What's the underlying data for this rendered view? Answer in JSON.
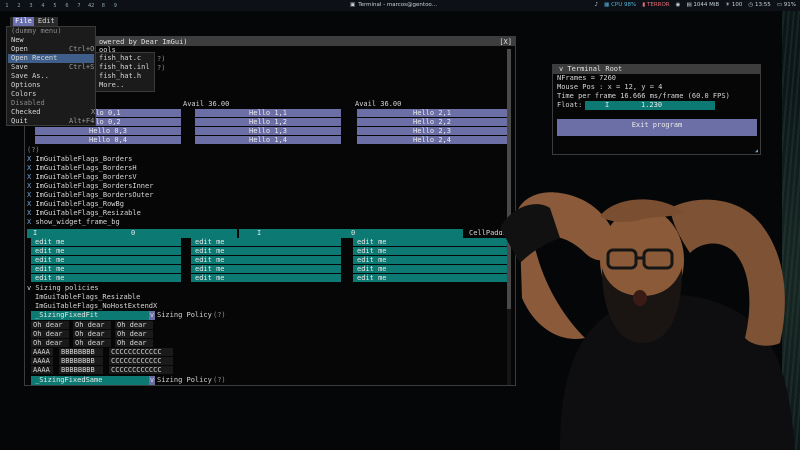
{
  "topbar": {
    "workspaces": [
      "1",
      "2",
      "3",
      "4",
      "5",
      "6",
      "7",
      "8",
      "9"
    ],
    "workspace_count": "42",
    "window_title": "Terminal - marcos@gentoo...",
    "cpu": "CPU 98%",
    "temp": "TERROR",
    "memory": "1044 MiB",
    "brightness": "100",
    "clock": "13:55",
    "battery": "91%"
  },
  "menubar": {
    "file": "File",
    "edit": "Edit"
  },
  "file_menu": {
    "header": "(dummy menu)",
    "items": [
      {
        "label": "New",
        "shortcut": ""
      },
      {
        "label": "Open",
        "shortcut": "Ctrl+O"
      },
      {
        "label": "Open Recent",
        "shortcut": ""
      },
      {
        "label": "Save",
        "shortcut": "Ctrl+S"
      },
      {
        "label": "Save As..",
        "shortcut": ""
      },
      {
        "label": "Options",
        "shortcut": ""
      },
      {
        "label": "Colors",
        "shortcut": ""
      },
      {
        "label": "Disabled",
        "shortcut": ""
      },
      {
        "label": "Checked",
        "shortcut": "X"
      },
      {
        "label": "Quit",
        "shortcut": "Alt+F4"
      }
    ]
  },
  "recent_menu": {
    "items": [
      "fish_hat.c",
      "fish_hat.inl",
      "fish_hat.h",
      "More.."
    ]
  },
  "imgui_window": {
    "title": "owered by Dear ImGui)",
    "close": "[X]",
    "line_tools": "ools",
    "q1": "?)",
    "q2": "?)",
    "avail1": "Avail 36.00",
    "avail2": "Avail 36.00",
    "col0": [
      "lo 0,1",
      "lo 0,2",
      "Hello 0,3",
      "Hello 0,4"
    ],
    "col1": [
      "Hello 1,1",
      "Hello 1,2",
      "Hello 1,3",
      "Hello 1,4"
    ],
    "col2": [
      "Hello 2,1",
      "Hello 2,2",
      "Hello 2,3",
      "Hello 2,4"
    ],
    "q3": "(?)",
    "flags": [
      "ImGuiTableFlags_Borders",
      "ImGuiTableFlags_BordersH",
      "ImGuiTableFlags_BordersV",
      "ImGuiTableFlags_BordersInner",
      "ImGuiTableFlags_BordersOuter",
      "ImGuiTableFlags_RowBg",
      "ImGuiTableFlags_Resizable",
      "show_widget_frame_bg"
    ],
    "checked_flag": "X",
    "slider_row": {
      "slider1": "0",
      "slider2": "0",
      "cell_padding": "CellPaddin",
      "cursor": "I"
    },
    "edit_me": "edit me",
    "edit_rows": 5,
    "sizing_header": "v Sizing policies",
    "sizing_flags": [
      "ImGuiTableFlags_Resizable",
      "ImGuiTableFlags_NoHostExtendX"
    ],
    "combo1": "_SizingFixedFit",
    "combo_arrow": "v",
    "sizing_policy": "Sizing Policy",
    "help": "(?)",
    "oh_dear": "Oh dear",
    "aaaa": "AAAA",
    "bbbb": "BBBBBBBB",
    "cccc": "CCCCCCCCCCCC",
    "combo2": "_SizingFixedSame"
  },
  "terminal_root": {
    "title": "v Terminal Root",
    "nframes": "NFrames = 7260",
    "mouse_pos": "Mouse Pos : x = 12, y = 4",
    "frame_time": "Time per frame 16.666 ms/frame (60.0 FPS)",
    "float_label": "Float:",
    "float_value": "1.230",
    "float_cursor": "I",
    "exit_button": "Exit program"
  },
  "colors": {
    "accent_blue": "#6c6fa6",
    "accent_teal": "#0c7a72",
    "menu_highlight": "#3f5f8a",
    "cpu": "#4fb3d9",
    "temp": "#e06c75"
  }
}
